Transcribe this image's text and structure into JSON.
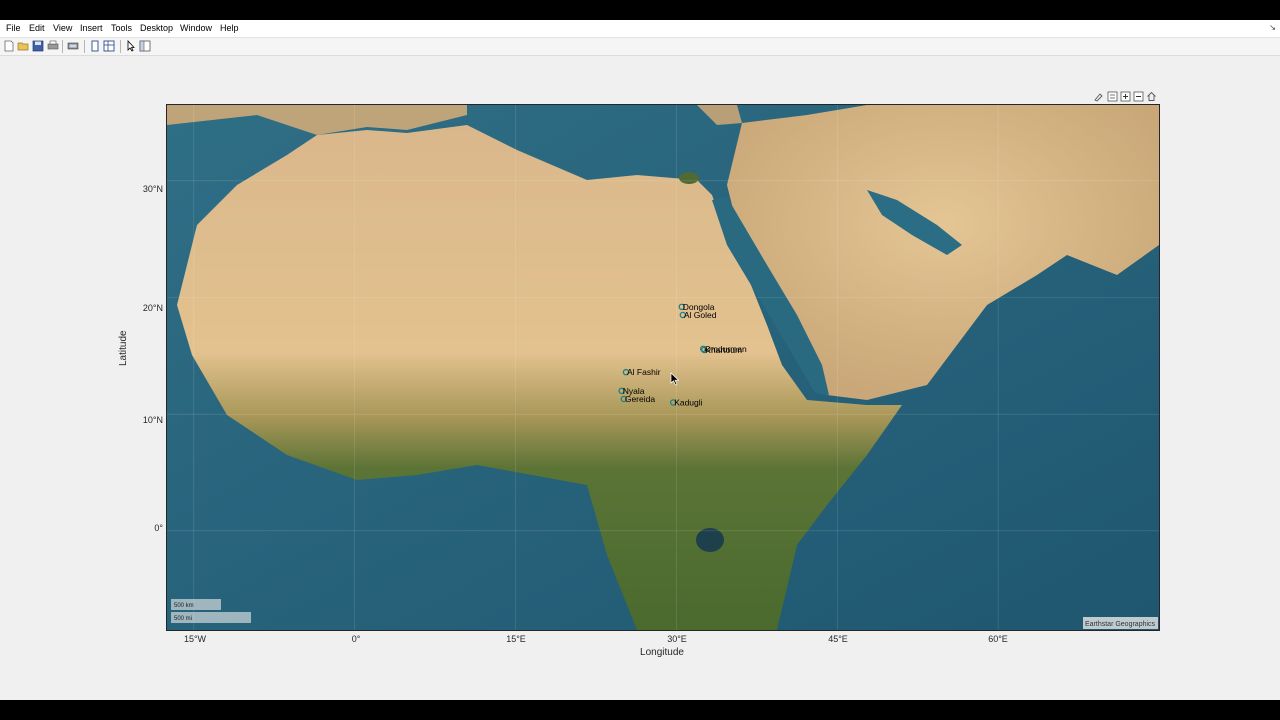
{
  "menu": {
    "items": [
      "File",
      "Edit",
      "View",
      "Insert",
      "Tools",
      "Desktop",
      "Window",
      "Help"
    ]
  },
  "toolbar": {
    "icons": [
      "new-figure-icon",
      "open-file-icon",
      "save-icon",
      "print-icon",
      "print-preview-icon",
      "dock-figure-icon",
      "property-editor-icon",
      "edit-plot-icon",
      "plot-browser-icon"
    ]
  },
  "axes_toolbar": {
    "icons": [
      "brush-icon",
      "data-tips-icon",
      "zoom-in-icon",
      "zoom-out-icon",
      "restore-view-icon"
    ]
  },
  "map": {
    "basemap": "satellite",
    "xlabel": "Longitude",
    "ylabel": "Latitude",
    "lon_ticks": [
      "15°W",
      "0°",
      "15°E",
      "30°E",
      "45°E",
      "60°E"
    ],
    "lat_ticks": [
      "30°N",
      "20°N",
      "10°N",
      "0°"
    ],
    "lon_range": [
      -17.5,
      75
    ],
    "lat_range": [
      -8.5,
      36.5
    ],
    "cities": [
      {
        "name": "Dongola",
        "lat": 19.2,
        "lon": 30.5
      },
      {
        "name": "Al Goled",
        "lat": 18.5,
        "lon": 30.6
      },
      {
        "name": "Omdurman",
        "lat": 15.6,
        "lon": 32.5
      },
      {
        "name": "Khartoum",
        "lat": 15.5,
        "lon": 32.6
      },
      {
        "name": "Al Fashir",
        "lat": 13.6,
        "lon": 25.3
      },
      {
        "name": "Nyala",
        "lat": 12.0,
        "lon": 24.9
      },
      {
        "name": "Gereida",
        "lat": 11.3,
        "lon": 25.1
      },
      {
        "name": "Kadugli",
        "lat": 11.0,
        "lon": 29.7
      }
    ],
    "scalebar": {
      "km": "500 km",
      "mi": "500 mi"
    },
    "attribution": "Earthstar Geographics",
    "colors": {
      "ocean": "#2e6e86",
      "desert": "#dcb98a",
      "vegetation": "#4f6a32",
      "marker": "#1a7f86"
    }
  }
}
